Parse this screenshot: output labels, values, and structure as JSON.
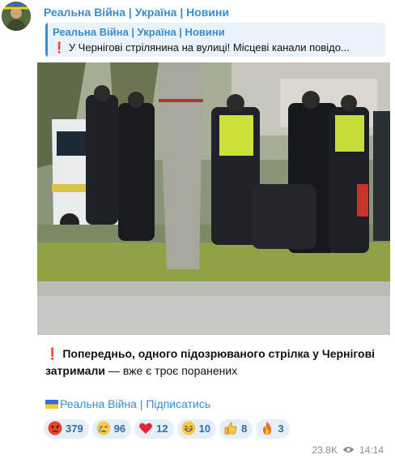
{
  "channel": {
    "name": "Реальна Війна | Україна | Новини",
    "avatar_icon": "soldier-avatar"
  },
  "reply": {
    "title": "Реальна Війна | Україна | Новини",
    "exclamation": "❗",
    "text": "У Чернігові стрілянина на вулиці! Місцеві канали повідо..."
  },
  "post": {
    "exclamation": "❗",
    "text_bold": "Попередньо, одного підозрюваного стрілка у Чернігові затримали",
    "text_rest": " — вже є троє поранених",
    "subscribe_flag": "ukraine-flag",
    "subscribe_text": "Реальна Війна | Підписатись"
  },
  "reactions": [
    {
      "icon": "angry-face-icon",
      "count": "379"
    },
    {
      "icon": "crying-face-icon",
      "count": "96"
    },
    {
      "icon": "heart-icon",
      "count": "12"
    },
    {
      "icon": "grinning-face-icon",
      "count": "10"
    },
    {
      "icon": "thumbs-up-icon",
      "count": "8"
    },
    {
      "icon": "fire-icon",
      "count": "3"
    }
  ],
  "meta": {
    "views": "23.8K",
    "time": "14:14"
  },
  "colors": {
    "accent": "#3a8ccf",
    "reaction_bg": "#e6eff7",
    "exclamation": "#e11d1d"
  }
}
